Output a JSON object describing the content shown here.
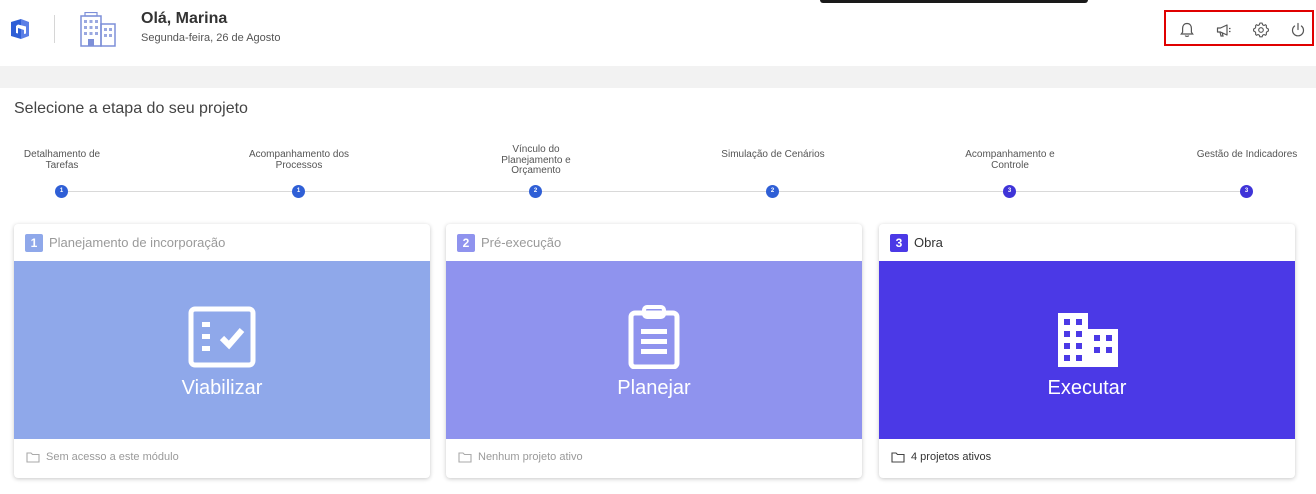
{
  "header": {
    "greeting": "Olá, Marina",
    "date": "Segunda-feira, 26 de Agosto",
    "icons": [
      "bell-icon",
      "megaphone-icon",
      "gear-icon",
      "power-icon"
    ]
  },
  "page": {
    "title": "Selecione a etapa do seu projeto"
  },
  "stepper": {
    "steps": [
      {
        "label": "Detalhamento de Tarefas",
        "number": "1"
      },
      {
        "label": "Acompanhamento dos Processos",
        "number": "1"
      },
      {
        "label": "Vínculo do Planejamento e Orçamento",
        "number": "2"
      },
      {
        "label": "Simulação de Cenários",
        "number": "2"
      },
      {
        "label": "Acompanhamento e Controle",
        "number": "3"
      },
      {
        "label": "Gestão de Indicadores",
        "number": "3"
      }
    ]
  },
  "cards": [
    {
      "number": "1",
      "title": "Planejamento de incorporação",
      "action": "Viabilizar",
      "status": "Sem acesso a este módulo",
      "color": "#8fa8ea",
      "icon": "checklist-icon"
    },
    {
      "number": "2",
      "title": "Pré-execução",
      "action": "Planejar",
      "status": "Nenhum projeto ativo",
      "color": "#8f93ee",
      "icon": "clipboard-icon"
    },
    {
      "number": "3",
      "title": "Obra",
      "action": "Executar",
      "status": "4 projetos ativos",
      "color": "#4b39e6",
      "icon": "building-icon"
    }
  ],
  "colors": {
    "primary": "#4b39e6",
    "step_dot": "#2f5fd6",
    "highlight_border": "#e00000"
  }
}
